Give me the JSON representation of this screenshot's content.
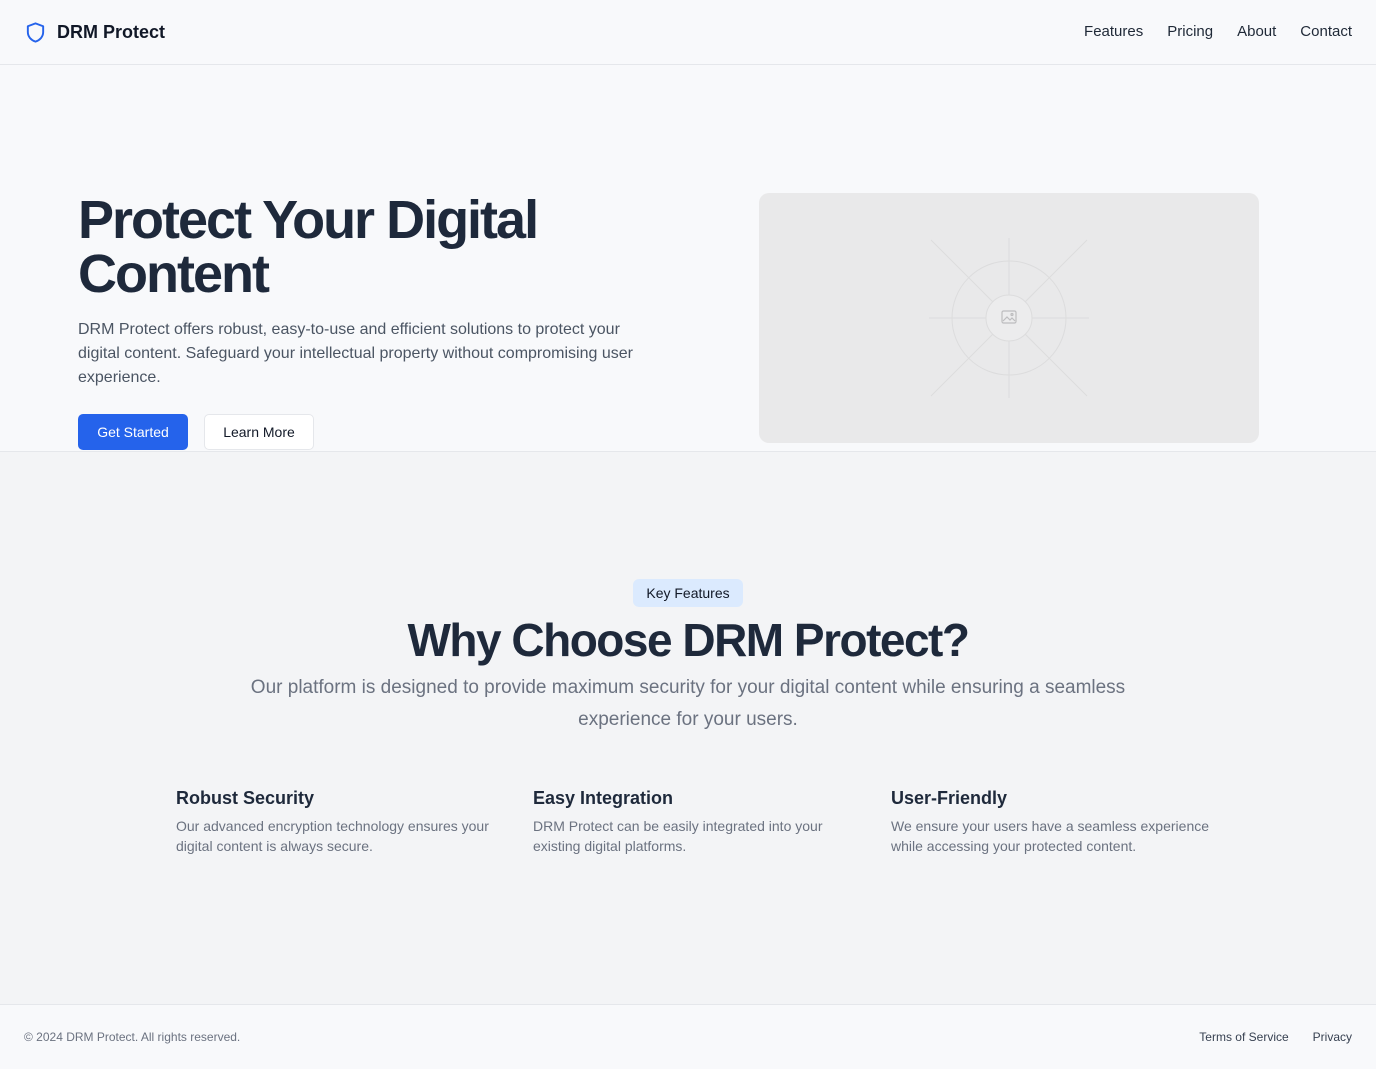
{
  "header": {
    "brand": "DRM Protect",
    "nav": [
      "Features",
      "Pricing",
      "About",
      "Contact"
    ]
  },
  "hero": {
    "title": "Protect Your Digital Content",
    "description": "DRM Protect offers robust, easy-to-use and efficient solutions to protect your digital content. Safeguard your intellectual property without compromising user experience.",
    "primary_button": "Get Started",
    "secondary_button": "Learn More"
  },
  "features": {
    "badge": "Key Features",
    "title": "Why Choose DRM Protect?",
    "description": "Our platform is designed to provide maximum security for your digital content while ensuring a seamless experience for your users.",
    "items": [
      {
        "title": "Robust Security",
        "description": "Our advanced encryption technology ensures your digital content is always secure."
      },
      {
        "title": "Easy Integration",
        "description": "DRM Protect can be easily integrated into your existing digital platforms."
      },
      {
        "title": "User-Friendly",
        "description": "We ensure your users have a seamless experience while accessing your protected content."
      }
    ]
  },
  "footer": {
    "copyright": "© 2024 DRM Protect. All rights reserved.",
    "links": [
      "Terms of Service",
      "Privacy"
    ]
  },
  "colors": {
    "accent": "#2563eb",
    "badge_bg": "#dbeafe",
    "heading": "#1e293b",
    "muted": "#6b7280"
  },
  "icons": {
    "brand": "shield-icon",
    "hero_placeholder": "image-placeholder-icon"
  }
}
